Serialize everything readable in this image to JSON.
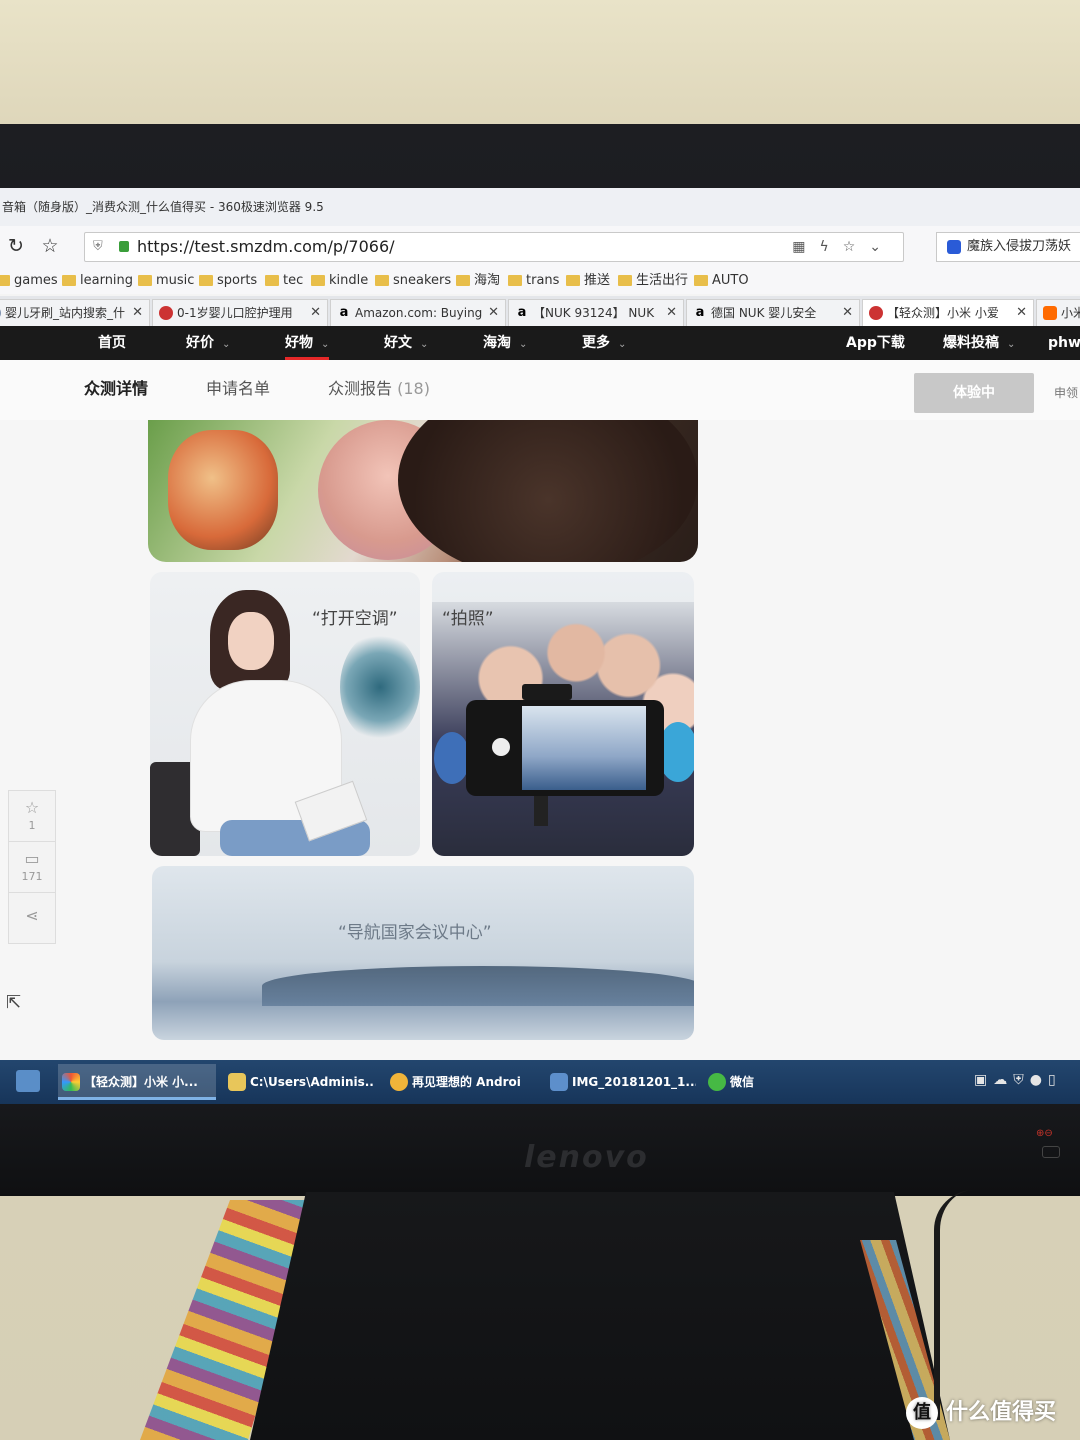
{
  "window": {
    "title": "音箱（随身版）_消费众测_什么值得买 - 360极速浏览器 9.5"
  },
  "addressbar": {
    "url": "https://test.smzdm.com/p/7066/",
    "search_text": "魔族入侵拔刀荡妖"
  },
  "bookmarks": [
    "games",
    "learning",
    "music",
    "sports",
    "tec",
    "kindle",
    "sneakers",
    "海淘",
    "trans",
    "推送",
    "生活出行",
    "AUTO"
  ],
  "tabs": [
    {
      "label": "婴儿牙刷_站内搜索_什",
      "icon": "search-favicon"
    },
    {
      "label": "0-1岁婴儿口腔护理用",
      "icon": "smzdm-favicon"
    },
    {
      "label": "Amazon.com: Buying",
      "icon": "amazon-favicon"
    },
    {
      "label": "【NUK 93124】 NUK",
      "icon": "amazon-favicon"
    },
    {
      "label": "德国 NUK 婴儿安全",
      "icon": "amazon-favicon"
    },
    {
      "label": "【轻众测】小米 小爱",
      "icon": "smzdm-favicon",
      "active": true
    },
    {
      "label": "小米",
      "icon": "mi-favicon"
    }
  ],
  "site_nav": {
    "items": [
      {
        "label": "首页",
        "dropdown": false
      },
      {
        "label": "好价",
        "dropdown": true
      },
      {
        "label": "好物",
        "dropdown": true,
        "active": true
      },
      {
        "label": "好文",
        "dropdown": true
      },
      {
        "label": "海淘",
        "dropdown": true
      },
      {
        "label": "更多",
        "dropdown": true
      }
    ],
    "right": [
      {
        "label": "App下载",
        "dropdown": false
      },
      {
        "label": "爆料投稿",
        "dropdown": true
      },
      {
        "label": "phwa",
        "dropdown": false
      }
    ],
    "caret": "⌄"
  },
  "subtabs": {
    "items": [
      {
        "label": "众测详情",
        "active": true
      },
      {
        "label": "申请名单"
      },
      {
        "label": "众测报告",
        "count": "(18)"
      }
    ],
    "trial_button": "体验中",
    "apply_link": "申领"
  },
  "content": {
    "quote_ac": "“打开空调”",
    "quote_photo": "“拍照”",
    "quote_nav": "“导航国家会议中心”"
  },
  "side_toolbar": {
    "favorite_count": "1",
    "comment_count": "171"
  },
  "taskbar": {
    "items": [
      {
        "label": "【轻众测】小米 小...",
        "active": true
      },
      {
        "label": "C:\\Users\\Adminis..."
      },
      {
        "label": "再见理想的 Androi"
      },
      {
        "label": "IMG_20181201_1..."
      },
      {
        "label": "微信"
      }
    ]
  },
  "monitor": {
    "brand": "lenovo"
  },
  "watermark": {
    "text": "什么值得买",
    "logo": "值"
  },
  "colors": {
    "nav_bg": "#1a1a1a",
    "accent_red": "#e62828",
    "taskbar": "#1d3f66",
    "folder": "#e8be4a"
  }
}
